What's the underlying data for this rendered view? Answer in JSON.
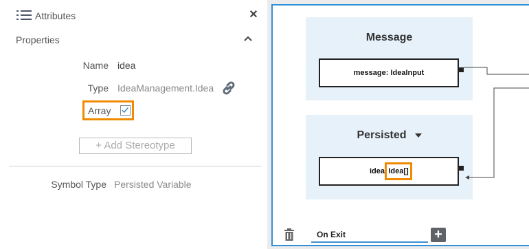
{
  "panel": {
    "title": "Attributes",
    "close_icon": "✕",
    "section_title": "Properties",
    "fields": {
      "name_label": "Name",
      "name_value": "idea",
      "type_label": "Type",
      "type_value": "IdeaManagement.Idea",
      "array_label": "Array",
      "array_checked": true,
      "add_stereotype": "+ Add Stereotype",
      "symbol_type_label": "Symbol Type",
      "symbol_type_value": "Persisted Variable"
    },
    "icons": {
      "list": "list-icon",
      "close": "close-icon",
      "collapse": "chevron-up-icon",
      "link": "link-icon",
      "check": "checkmark-icon"
    }
  },
  "canvas": {
    "message_block": {
      "title": "Message",
      "node_label": "message: IdeaInput"
    },
    "persisted_block": {
      "title": "Persisted",
      "node_prefix": "idea",
      "node_type": "Idea[]"
    },
    "footer": {
      "tab_label": "On Exit",
      "add_label": "+"
    },
    "colors": {
      "highlight": "#f08a00",
      "border_accent": "#2f8fd8",
      "block_bg": "#e6f1fa"
    }
  }
}
